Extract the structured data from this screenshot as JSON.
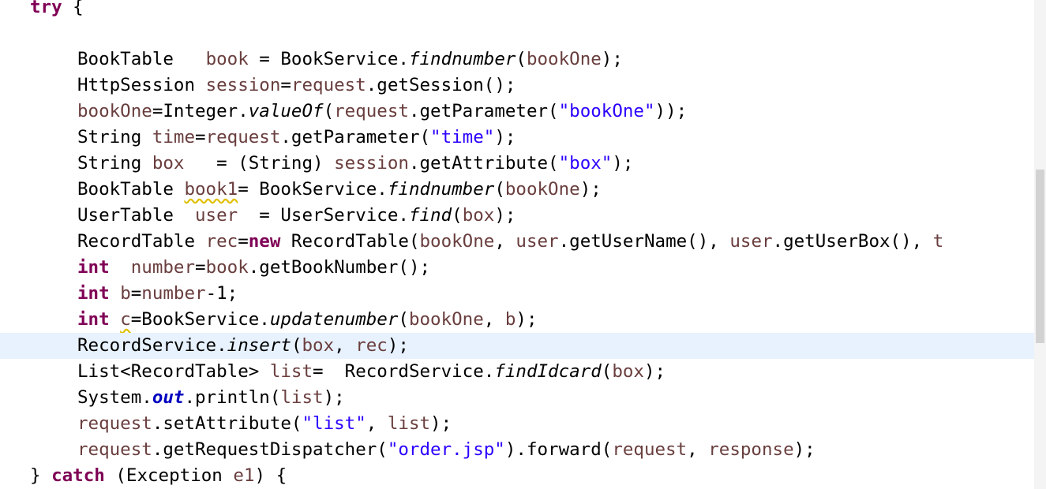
{
  "lines": [
    {
      "indent": 0,
      "current": false,
      "tokens": [
        {
          "c": "kw",
          "t": "try"
        },
        {
          "c": "",
          "t": " {"
        }
      ]
    },
    {
      "indent": 0,
      "current": false,
      "tokens": []
    },
    {
      "indent": 1,
      "current": false,
      "tokens": [
        {
          "c": "",
          "t": "BookTable   "
        },
        {
          "c": "var",
          "t": "book"
        },
        {
          "c": "",
          "t": " = BookService."
        },
        {
          "c": "it",
          "t": "findnumber"
        },
        {
          "c": "",
          "t": "("
        },
        {
          "c": "var",
          "t": "bookOne"
        },
        {
          "c": "",
          "t": ");"
        }
      ]
    },
    {
      "indent": 1,
      "current": false,
      "tokens": [
        {
          "c": "",
          "t": "HttpSession "
        },
        {
          "c": "var",
          "t": "session"
        },
        {
          "c": "",
          "t": "="
        },
        {
          "c": "var",
          "t": "request"
        },
        {
          "c": "",
          "t": ".getSession();"
        }
      ]
    },
    {
      "indent": 1,
      "current": false,
      "tokens": [
        {
          "c": "var",
          "t": "bookOne"
        },
        {
          "c": "",
          "t": "=Integer."
        },
        {
          "c": "it",
          "t": "valueOf"
        },
        {
          "c": "",
          "t": "("
        },
        {
          "c": "var",
          "t": "request"
        },
        {
          "c": "",
          "t": ".getParameter("
        },
        {
          "c": "str",
          "t": "\"bookOne\""
        },
        {
          "c": "",
          "t": "));"
        }
      ]
    },
    {
      "indent": 1,
      "current": false,
      "tokens": [
        {
          "c": "",
          "t": "String "
        },
        {
          "c": "var",
          "t": "time"
        },
        {
          "c": "",
          "t": "="
        },
        {
          "c": "var",
          "t": "request"
        },
        {
          "c": "",
          "t": ".getParameter("
        },
        {
          "c": "str",
          "t": "\"time\""
        },
        {
          "c": "",
          "t": ");"
        }
      ]
    },
    {
      "indent": 1,
      "current": false,
      "tokens": [
        {
          "c": "",
          "t": "String "
        },
        {
          "c": "var",
          "t": "box"
        },
        {
          "c": "",
          "t": "   = (String) "
        },
        {
          "c": "var",
          "t": "session"
        },
        {
          "c": "",
          "t": ".getAttribute("
        },
        {
          "c": "str",
          "t": "\"box\""
        },
        {
          "c": "",
          "t": ");"
        }
      ]
    },
    {
      "indent": 1,
      "current": false,
      "tokens": [
        {
          "c": "",
          "t": "BookTable "
        },
        {
          "c": "var squig",
          "t": "book1"
        },
        {
          "c": "",
          "t": "= BookService."
        },
        {
          "c": "it",
          "t": "findnumber"
        },
        {
          "c": "",
          "t": "("
        },
        {
          "c": "var",
          "t": "bookOne"
        },
        {
          "c": "",
          "t": ");"
        }
      ]
    },
    {
      "indent": 1,
      "current": false,
      "tokens": [
        {
          "c": "",
          "t": "UserTable  "
        },
        {
          "c": "var",
          "t": "user"
        },
        {
          "c": "",
          "t": "  = UserService."
        },
        {
          "c": "it",
          "t": "find"
        },
        {
          "c": "",
          "t": "("
        },
        {
          "c": "var",
          "t": "box"
        },
        {
          "c": "",
          "t": ");"
        }
      ]
    },
    {
      "indent": 1,
      "current": false,
      "tokens": [
        {
          "c": "",
          "t": "RecordTable "
        },
        {
          "c": "var",
          "t": "rec"
        },
        {
          "c": "",
          "t": "="
        },
        {
          "c": "kw",
          "t": "new"
        },
        {
          "c": "",
          "t": " RecordTable("
        },
        {
          "c": "var",
          "t": "bookOne"
        },
        {
          "c": "",
          "t": ", "
        },
        {
          "c": "var",
          "t": "user"
        },
        {
          "c": "",
          "t": ".getUserName(), "
        },
        {
          "c": "var",
          "t": "user"
        },
        {
          "c": "",
          "t": ".getUserBox(), "
        },
        {
          "c": "var",
          "t": "t"
        }
      ]
    },
    {
      "indent": 1,
      "current": false,
      "tokens": [
        {
          "c": "kw",
          "t": "int"
        },
        {
          "c": "",
          "t": "  "
        },
        {
          "c": "var",
          "t": "number"
        },
        {
          "c": "",
          "t": "="
        },
        {
          "c": "var",
          "t": "book"
        },
        {
          "c": "",
          "t": ".getBookNumber();"
        }
      ]
    },
    {
      "indent": 1,
      "current": false,
      "tokens": [
        {
          "c": "kw",
          "t": "int"
        },
        {
          "c": "",
          "t": " "
        },
        {
          "c": "var",
          "t": "b"
        },
        {
          "c": "",
          "t": "="
        },
        {
          "c": "var",
          "t": "number"
        },
        {
          "c": "",
          "t": "-1;"
        }
      ]
    },
    {
      "indent": 1,
      "current": false,
      "tokens": [
        {
          "c": "kw",
          "t": "int"
        },
        {
          "c": "",
          "t": " "
        },
        {
          "c": "var squig",
          "t": "c"
        },
        {
          "c": "",
          "t": "=BookService."
        },
        {
          "c": "it",
          "t": "updatenumber"
        },
        {
          "c": "",
          "t": "("
        },
        {
          "c": "var",
          "t": "bookOne"
        },
        {
          "c": "",
          "t": ", "
        },
        {
          "c": "var",
          "t": "b"
        },
        {
          "c": "",
          "t": ");"
        }
      ]
    },
    {
      "indent": 1,
      "current": true,
      "tokens": [
        {
          "c": "",
          "t": "RecordService."
        },
        {
          "c": "it",
          "t": "insert"
        },
        {
          "c": "",
          "t": "("
        },
        {
          "c": "var",
          "t": "box"
        },
        {
          "c": "",
          "t": ", "
        },
        {
          "c": "var",
          "t": "rec"
        },
        {
          "c": "",
          "t": ");"
        }
      ]
    },
    {
      "indent": 1,
      "current": false,
      "tokens": [
        {
          "c": "",
          "t": "List<RecordTable> "
        },
        {
          "c": "var",
          "t": "list"
        },
        {
          "c": "",
          "t": "=  RecordService."
        },
        {
          "c": "it",
          "t": "findIdcard"
        },
        {
          "c": "",
          "t": "("
        },
        {
          "c": "var",
          "t": "box"
        },
        {
          "c": "",
          "t": ");"
        }
      ]
    },
    {
      "indent": 1,
      "current": false,
      "tokens": [
        {
          "c": "",
          "t": "System."
        },
        {
          "c": "static",
          "t": "out"
        },
        {
          "c": "",
          "t": ".println("
        },
        {
          "c": "var",
          "t": "list"
        },
        {
          "c": "",
          "t": ");"
        }
      ]
    },
    {
      "indent": 1,
      "current": false,
      "tokens": [
        {
          "c": "var",
          "t": "request"
        },
        {
          "c": "",
          "t": ".setAttribute("
        },
        {
          "c": "str",
          "t": "\"list\""
        },
        {
          "c": "",
          "t": ", "
        },
        {
          "c": "var",
          "t": "list"
        },
        {
          "c": "",
          "t": ");"
        }
      ]
    },
    {
      "indent": 1,
      "current": false,
      "tokens": [
        {
          "c": "var",
          "t": "request"
        },
        {
          "c": "",
          "t": ".getRequestDispatcher("
        },
        {
          "c": "str",
          "t": "\"order.jsp\""
        },
        {
          "c": "",
          "t": ").forward("
        },
        {
          "c": "var",
          "t": "request"
        },
        {
          "c": "",
          "t": ", "
        },
        {
          "c": "var",
          "t": "response"
        },
        {
          "c": "",
          "t": ");"
        }
      ]
    },
    {
      "indent": 0,
      "current": false,
      "tokens": [
        {
          "c": "",
          "t": "} "
        },
        {
          "c": "kw",
          "t": "catch"
        },
        {
          "c": "",
          "t": " (Exception "
        },
        {
          "c": "var",
          "t": "e1"
        },
        {
          "c": "",
          "t": ") {"
        }
      ]
    }
  ],
  "colors": {
    "keyword": "#7f0055",
    "local_variable": "#6a3e3e",
    "string": "#2a00ff",
    "static_field": "#0000c0",
    "current_line": "#e8f2fe",
    "warning_squiggle": "#e0c000"
  }
}
